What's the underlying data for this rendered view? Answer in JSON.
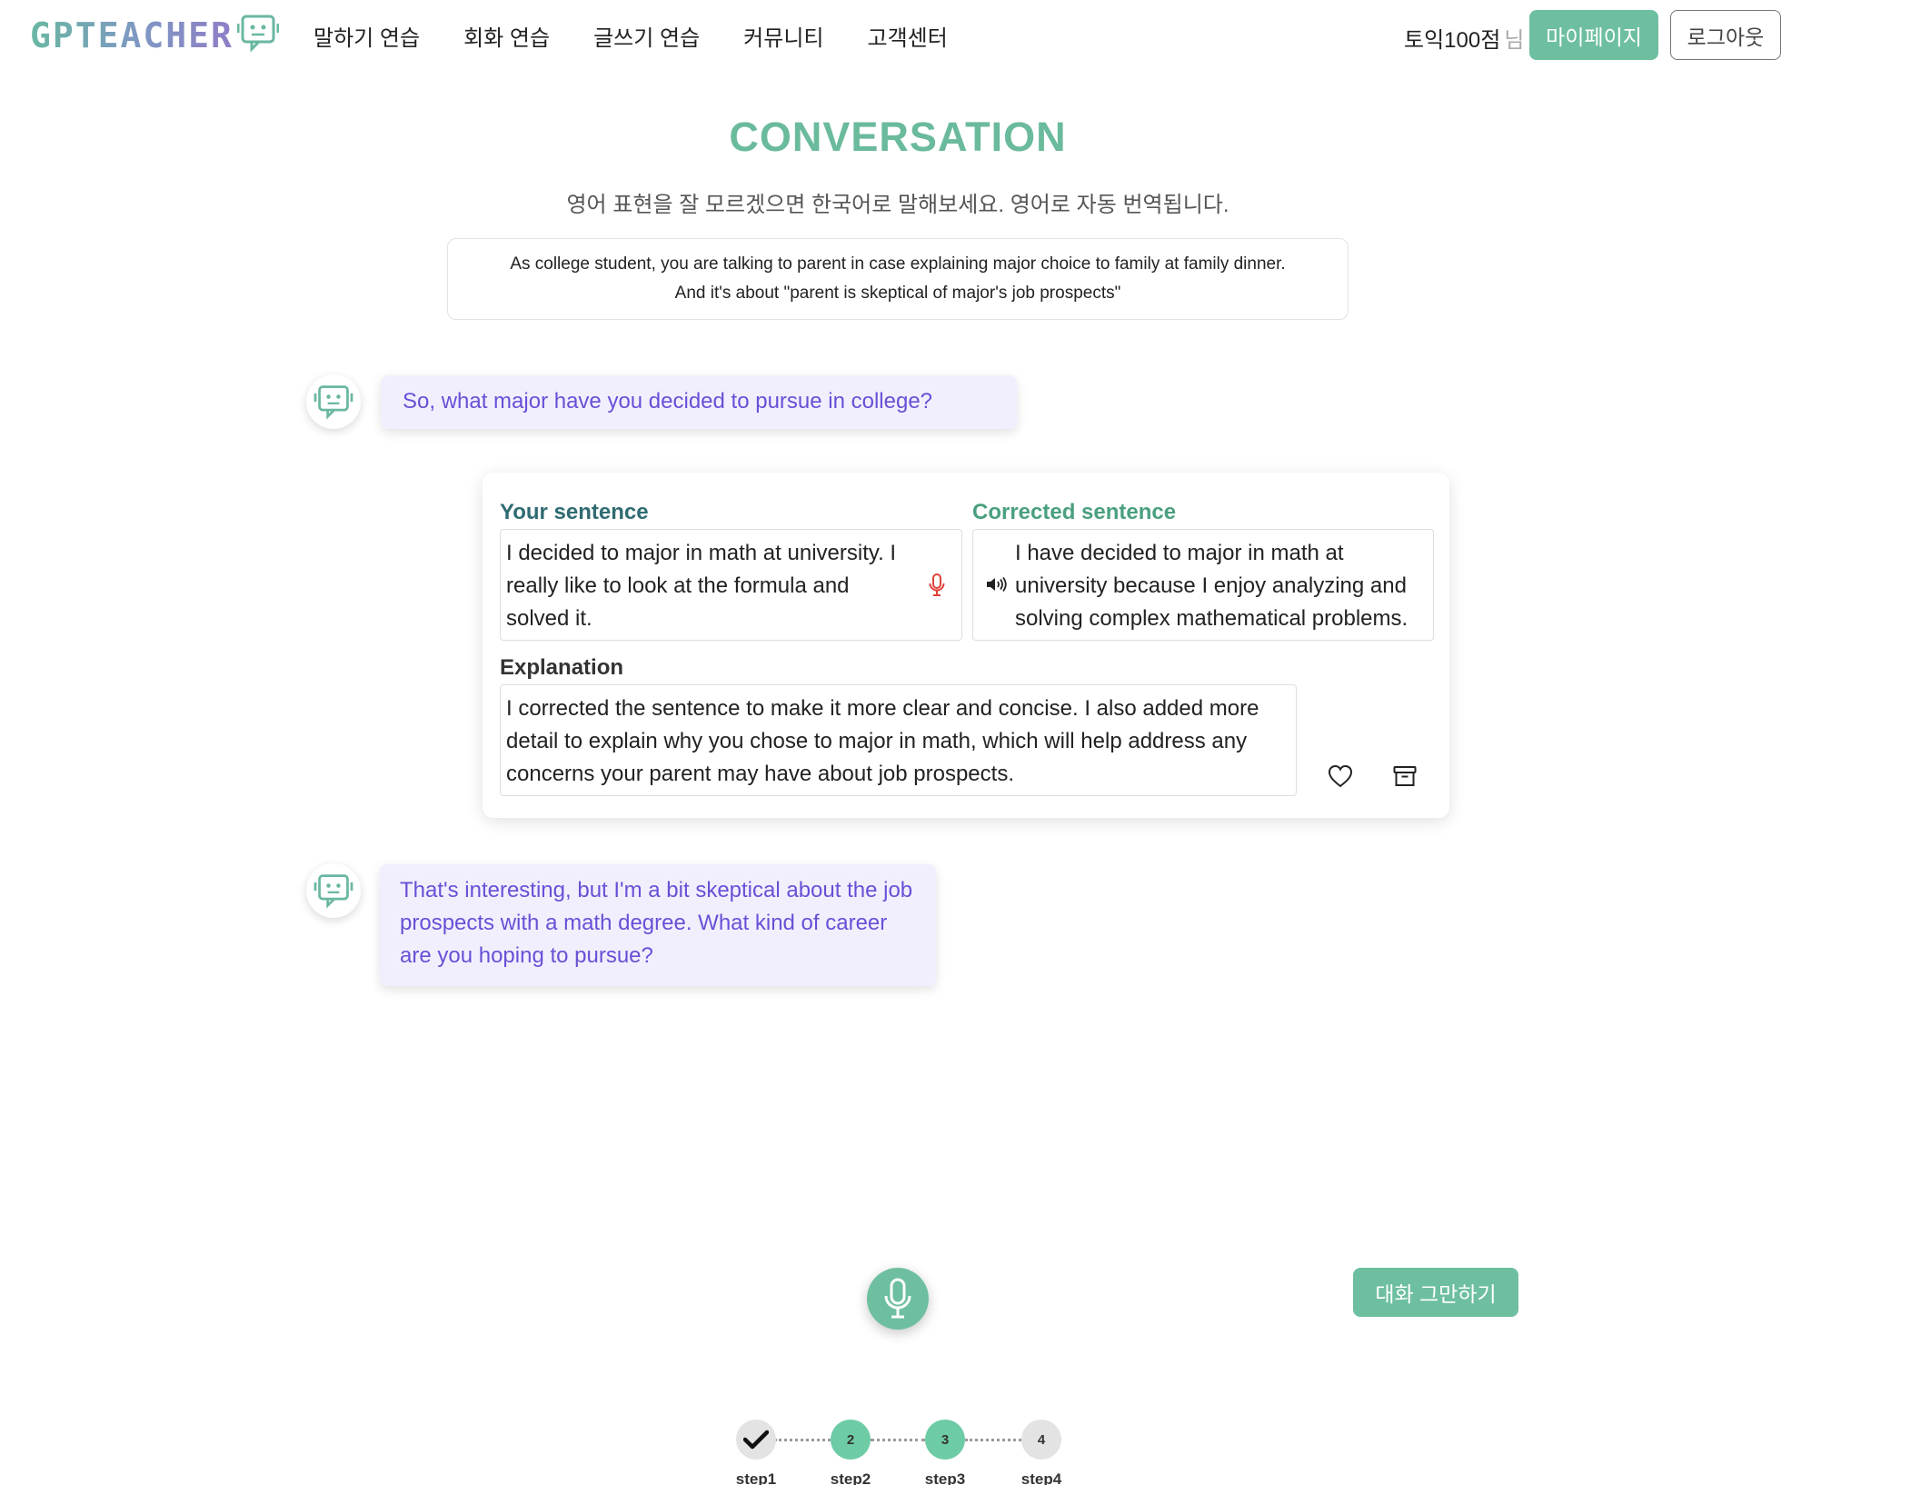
{
  "app": {
    "logo_text": "GPTEACHER",
    "brand_color": "#6dbfa0"
  },
  "nav": {
    "items": [
      "말하기 연습",
      "회화 연습",
      "글쓰기 연습",
      "커뮤니티",
      "고객센터"
    ]
  },
  "user": {
    "name": "토익100점",
    "suffix": "님",
    "mypage_label": "마이페이지",
    "logout_label": "로그아웃"
  },
  "page": {
    "title": "CONVERSATION",
    "subtitle": "영어 표현을 잘 모르겠으면 한국어로 말해보세요. 영어로 자동 번역됩니다.",
    "scenario_line1": "As college student, you are talking to parent in case explaining major choice to family at family dinner.",
    "scenario_line2": "And it's about \"parent is skeptical of major's job prospects\""
  },
  "messages": {
    "bot1": "So, what major have you decided to pursue in college?",
    "bot2": "That's interesting, but I'm a bit skeptical about the job prospects with a math degree. What kind of career are you hoping to pursue?"
  },
  "correction": {
    "your_label": "Your sentence",
    "your_text": "I decided to major in math at university. I really like to look at the formula and solved it.",
    "corrected_label": "Corrected sentence",
    "corrected_text": "I have decided to major in math at university because I enjoy analyzing and solving complex mathematical problems.",
    "explanation_label": "Explanation",
    "explanation_text": "I corrected the sentence to make it more clear and concise. I also added more detail to explain why you chose to major in math, which will help address any concerns your parent may have about job prospects."
  },
  "controls": {
    "stop_label": "대화 그만하기"
  },
  "steps": [
    {
      "number": "",
      "label": "step1",
      "state": "done"
    },
    {
      "number": "2",
      "label": "step2",
      "state": "active"
    },
    {
      "number": "3",
      "label": "step3",
      "state": "active"
    },
    {
      "number": "4",
      "label": "step4",
      "state": "todo"
    }
  ],
  "icons": {
    "logo": "robot-icon",
    "avatar": "robot-icon",
    "record": "microphone-icon",
    "play": "speaker-icon",
    "favorite": "heart-icon",
    "save": "archive-icon",
    "step_done": "check-icon"
  }
}
